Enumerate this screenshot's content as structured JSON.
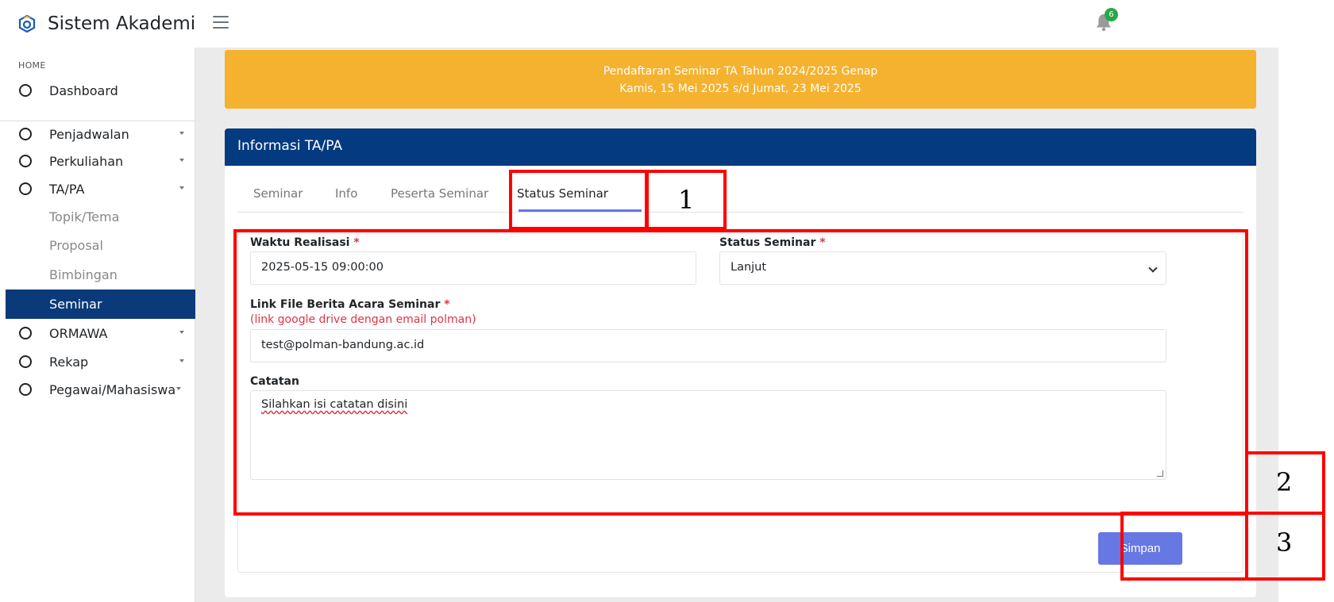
{
  "app": {
    "title": "Sistem Akademik",
    "notification_count": "6"
  },
  "sidebar": {
    "heading": "HOME",
    "dashboard": "Dashboard",
    "items": [
      {
        "label": "Penjadwalan"
      },
      {
        "label": "Perkuliahan"
      },
      {
        "label": "TA/PA"
      }
    ],
    "subitems": [
      "Topik/Tema",
      "Proposal",
      "Bimbingan",
      "Seminar"
    ],
    "items_after": [
      {
        "label": "ORMAWA"
      },
      {
        "label": "Rekap"
      },
      {
        "label": "Pegawai/Mahasiswa"
      }
    ]
  },
  "banner": {
    "line1": "Pendaftaran Seminar TA Tahun 2024/2025 Genap",
    "line2": "Kamis, 15 Mei 2025 s/d Jumat, 23 Mei 2025"
  },
  "card": {
    "title": "Informasi TA/PA",
    "tabs": [
      "Seminar",
      "Info",
      "Peserta Seminar",
      "Status Seminar"
    ]
  },
  "form": {
    "waktu_label": "Waktu Realisasi",
    "waktu_value": "2025-05-15 09:00:00",
    "status_label": "Status Seminar",
    "status_value": "Lanjut",
    "link_label": "Link File Berita Acara Seminar",
    "link_hint": "(link google drive dengan email polman)",
    "link_value": "test@polman-bandung.ac.id",
    "catatan_label": "Catatan",
    "catatan_value": "Silahkan isi catatan disini",
    "required_mark": "*",
    "save_label": "Simpan"
  },
  "annotations": [
    "1",
    "2",
    "3"
  ],
  "colors": {
    "primary": "#033a80",
    "banner": "#f5b22f",
    "accent": "#6777e3",
    "required": "#dc3545",
    "annotation": "#ff0000"
  },
  "icons": [
    "app-logo-icon",
    "menu-icon",
    "bell-icon"
  ]
}
